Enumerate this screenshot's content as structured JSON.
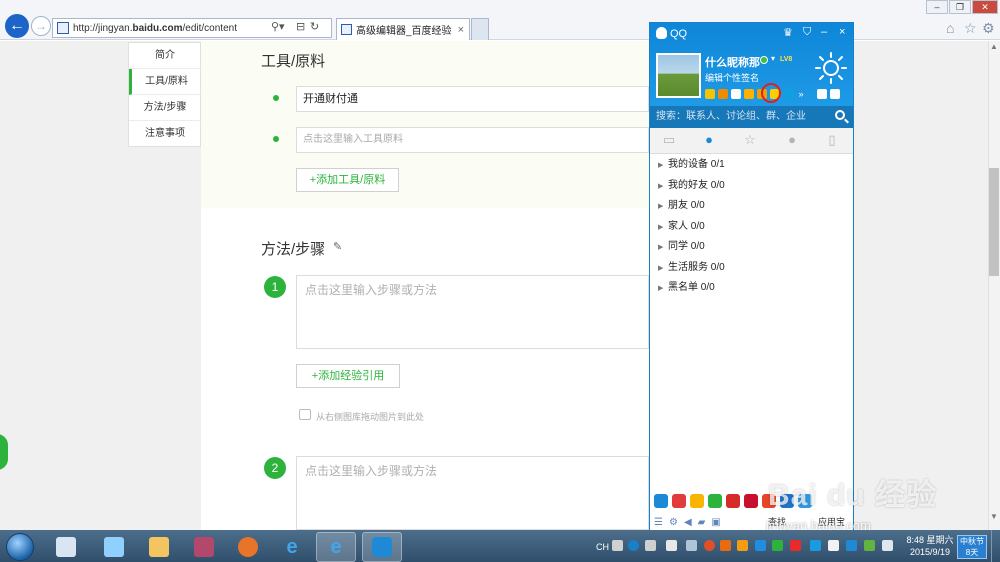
{
  "browser": {
    "address": "http://jingyan.baidu.com/edit/content",
    "address_prefix": "http://jingyan.",
    "address_domain": "baidu.com",
    "address_suffix": "/edit/content",
    "tab_title": "高级编辑器_百度经验",
    "tab_close": "×"
  },
  "sidebar": {
    "items": [
      {
        "label": "简介"
      },
      {
        "label": "工具/原料"
      },
      {
        "label": "方法/步骤"
      },
      {
        "label": "注意事项"
      }
    ]
  },
  "tools": {
    "title": "工具/原料",
    "items": [
      {
        "value": "开通财付通"
      },
      {
        "placeholder": "点击这里输入工具原料"
      }
    ],
    "add_button": "+添加工具/原料"
  },
  "steps": {
    "title": "方法/步骤",
    "items": [
      {
        "number": "1",
        "placeholder": "点击这里输入步骤或方法"
      },
      {
        "number": "2",
        "placeholder": "点击这里输入步骤或方法"
      }
    ],
    "add_reference_button": "+添加经验引用",
    "drag_hint": "从右侧图库拖动图片到此处"
  },
  "qq": {
    "title": "QQ",
    "minimize": "–",
    "close": "×",
    "nickname": "什么昵称那",
    "level_badge": "LV8",
    "signature": "编辑个性签名",
    "search_placeholder": "搜索：联系人、讨论组、群、企业",
    "groups": [
      {
        "label": "我的设备 0/1",
        "expanded": false
      },
      {
        "label": "我的好友 0/0",
        "expanded": true
      },
      {
        "label": "朋友 0/0",
        "expanded": false
      },
      {
        "label": "家人 0/0",
        "expanded": false
      },
      {
        "label": "同学 0/0",
        "expanded": false
      },
      {
        "label": "生活服务 0/0",
        "expanded": false
      },
      {
        "label": "黑名单 0/0",
        "expanded": false
      }
    ],
    "find_label": "查找",
    "app_manager_label": "应用宝",
    "colors": {
      "header": "#1e9ae6",
      "highlight_ring": "#e02020"
    }
  },
  "taskbar": {
    "tray_text": "CH",
    "time": "8:48 星期六",
    "date": "2015/9/19",
    "holiday_name": "中秋节",
    "holiday_days": "8天"
  },
  "watermark": {
    "logo": "Bai du 经验",
    "url": "jingyan.baidu.com"
  },
  "colors": {
    "accent_green": "#2db33b",
    "ie_blue": "#1d64c8"
  }
}
